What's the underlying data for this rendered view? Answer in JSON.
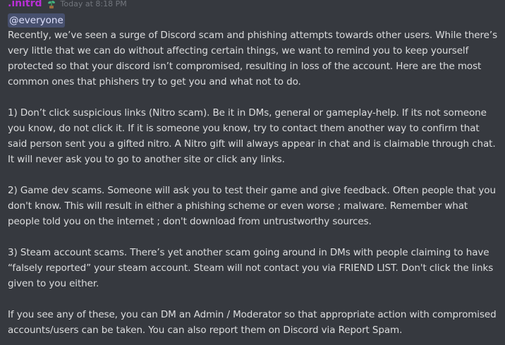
{
  "message": {
    "author": ".initrd",
    "timestamp": "Today at 8:18 PM",
    "role_icon": "plant-sprout-icon",
    "mention": "@everyone",
    "paragraphs": [
      "Recently, we’ve seen a surge of Discord scam and phishing attempts towards other users. While there’s very little that we can do without affecting certain things, we want to remind you to keep yourself protected so that your discord isn’t compromised, resulting in loss of the account. Here are the most common ones that phishers try to get you and what not to do.",
      "1) Don’t click suspicious links (Nitro scam).  Be it in DMs, general or gameplay-help. If its not someone you know, do not click it. If it is someone you know, try to contact them another way to confirm that said person sent you a gifted nitro. A Nitro gift will always appear in chat and is claimable through chat. It will never ask you to go to another site or click any links.",
      "2) Game dev scams. Someone will ask you to test their game and give feedback. Often people that you don't know. This will result in either a phishing scheme or even worse ; malware. Remember what people told you on the internet ; don't download from untrustworthy sources.",
      "3) Steam account scams. There’s yet another scam going around in DMs with people claiming to have “falsely reported” your steam account. Steam will not contact you via FRIEND LIST. Don't click the links given to you either.",
      "If you see any of these, you can DM an Admin / Moderator so that appropriate action with compromised accounts/users can be taken. You can also report them on Discord via Report Spam."
    ]
  },
  "colors": {
    "background": "#36393f",
    "text": "#dcddde",
    "username": "#b82fd6",
    "timestamp": "#72767d",
    "mention_bg": "rgba(114,137,218,0.3)"
  }
}
